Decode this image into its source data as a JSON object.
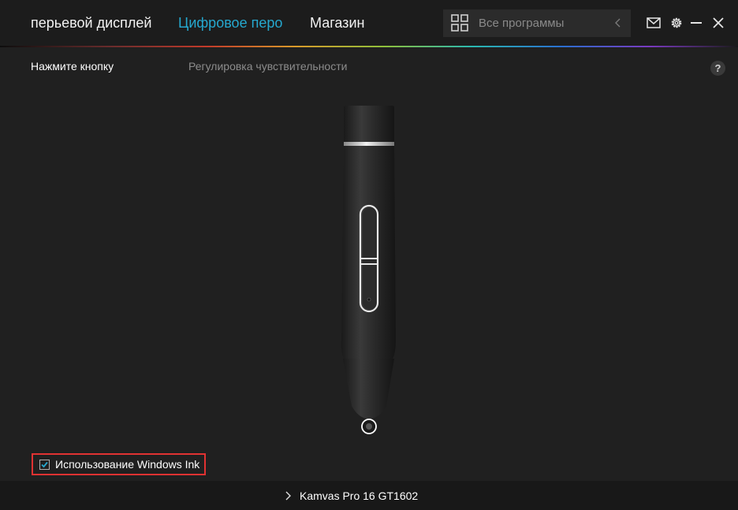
{
  "nav": {
    "tabs": [
      {
        "label": "перьевой дисплей",
        "active": false
      },
      {
        "label": "Цифровое перо",
        "active": true
      },
      {
        "label": "Магазин",
        "active": false
      }
    ]
  },
  "search": {
    "placeholder": "Все программы"
  },
  "subtabs": {
    "pressKey": "Нажмите кнопку",
    "sensitivity": "Регулировка чувствительности"
  },
  "help": {
    "label": "?"
  },
  "windowsInk": {
    "label": "Использование Windows Ink",
    "checked": true
  },
  "device": {
    "name": "Kamvas Pro 16 GT1602"
  },
  "colors": {
    "background": "#202020",
    "accent": "#25a8cf",
    "highlight_border": "#e03232"
  }
}
